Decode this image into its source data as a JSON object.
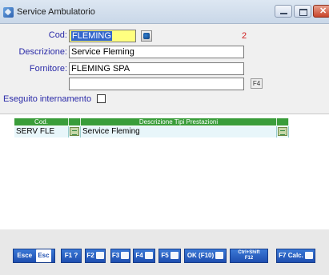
{
  "window": {
    "title": "Service Ambulatorio"
  },
  "form": {
    "cod_label": "Cod:",
    "cod_value": "FLEMING",
    "cod_count": "2",
    "descrizione_label": "Descrizione:",
    "descrizione_value": "Service Fleming",
    "fornitore_label": "Fornitore:",
    "fornitore_value": "FLEMING SPA",
    "extra_value": "",
    "f4_label": "F4",
    "eseguito_label": "Eseguito internamento",
    "eseguito_checked": false
  },
  "grid": {
    "headers": [
      "Cod.",
      "Descrizione Tipi Prestazioni"
    ],
    "rows": [
      {
        "cod": "SERV FLE",
        "descrizione": "Service Fleming"
      }
    ]
  },
  "toolbar": {
    "esce": "Esce",
    "esc": "Esc",
    "f1": "F1 ?",
    "f2": "F2",
    "f3": "F3",
    "f4": "F4",
    "f5": "F5",
    "ok": "OK (F10)",
    "ctrl_shift": "Ctrl+Shift",
    "f12": "F12",
    "f7": "F7 Calc."
  }
}
